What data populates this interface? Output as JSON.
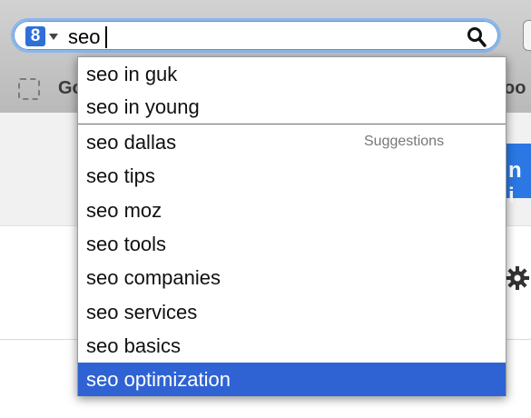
{
  "search": {
    "engine_icon": "g-letter-icon",
    "engine_letter": "8",
    "query": "seo"
  },
  "bookmarks": {
    "left_fragment": "Go",
    "right_fragment": "oo"
  },
  "page": {
    "button_fragment": "n i",
    "accent_color": "#2b78e4"
  },
  "dropdown": {
    "history_items": [
      {
        "label": "seo in guk"
      },
      {
        "label": "seo in young"
      }
    ],
    "section_label": "Suggestions",
    "suggestions": [
      {
        "label": "seo dallas"
      },
      {
        "label": "seo tips"
      },
      {
        "label": "seo moz"
      },
      {
        "label": "seo tools"
      },
      {
        "label": "seo companies"
      },
      {
        "label": "seo services"
      },
      {
        "label": "seo basics"
      },
      {
        "label": "seo optimization",
        "selected": true
      }
    ],
    "selected_color": "#2f63d3"
  }
}
